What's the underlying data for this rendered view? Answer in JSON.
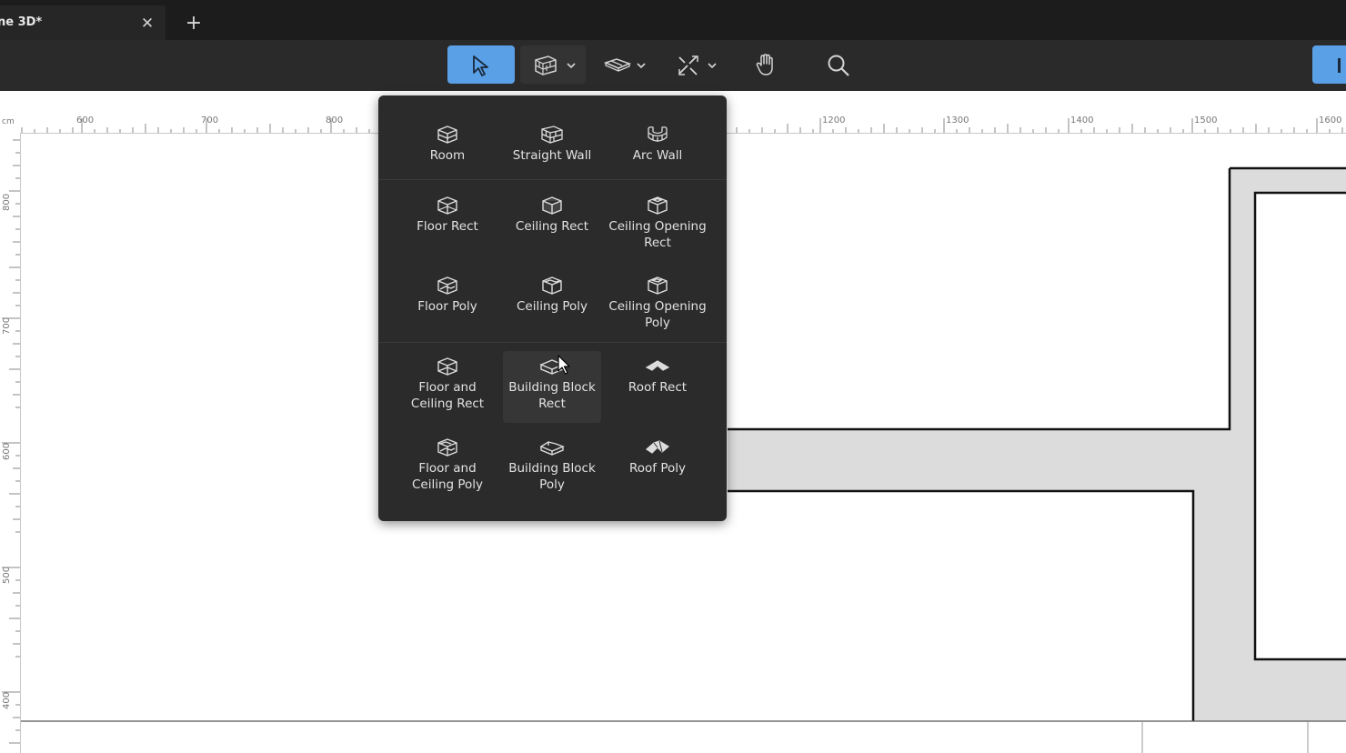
{
  "tab": {
    "title": "ne 3D*",
    "close_icon": "close-icon",
    "add_icon": "plus-icon"
  },
  "toolbar": {
    "tools": [
      "select-tool",
      "wall-tool",
      "floor-tool",
      "measure-tool",
      "pan-tool",
      "search-tool"
    ],
    "accent_color": "#5aa0e6"
  },
  "ruler": {
    "unit": "cm",
    "top_labels": [
      "600",
      "700",
      "800",
      "1200",
      "1300",
      "1400",
      "1500",
      "1600"
    ],
    "left_labels": [
      "800",
      "700",
      "600",
      "500",
      "400"
    ]
  },
  "menu": {
    "items": [
      {
        "label": "Room",
        "icon": "room-icon"
      },
      {
        "label": "Straight Wall",
        "icon": "straight-wall-icon"
      },
      {
        "label": "Arc Wall",
        "icon": "arc-wall-icon"
      },
      {
        "label": "Floor Rect",
        "icon": "floor-rect-icon"
      },
      {
        "label": "Ceiling Rect",
        "icon": "ceiling-rect-icon"
      },
      {
        "label": "Ceiling Opening Rect",
        "icon": "ceiling-opening-rect-icon"
      },
      {
        "label": "Floor Poly",
        "icon": "floor-poly-icon"
      },
      {
        "label": "Ceiling Poly",
        "icon": "ceiling-poly-icon"
      },
      {
        "label": "Ceiling Opening Poly",
        "icon": "ceiling-opening-poly-icon"
      },
      {
        "label": "Floor and Ceiling Rect",
        "icon": "floor-ceiling-rect-icon"
      },
      {
        "label": "Building Block Rect",
        "icon": "building-block-rect-icon"
      },
      {
        "label": "Roof Rect",
        "icon": "roof-rect-icon"
      },
      {
        "label": "Floor and Ceiling Poly",
        "icon": "floor-ceiling-poly-icon"
      },
      {
        "label": "Building Block Poly",
        "icon": "building-block-poly-icon"
      },
      {
        "label": "Roof Poly",
        "icon": "roof-poly-icon"
      }
    ],
    "hovered": "Building Block Rect"
  }
}
